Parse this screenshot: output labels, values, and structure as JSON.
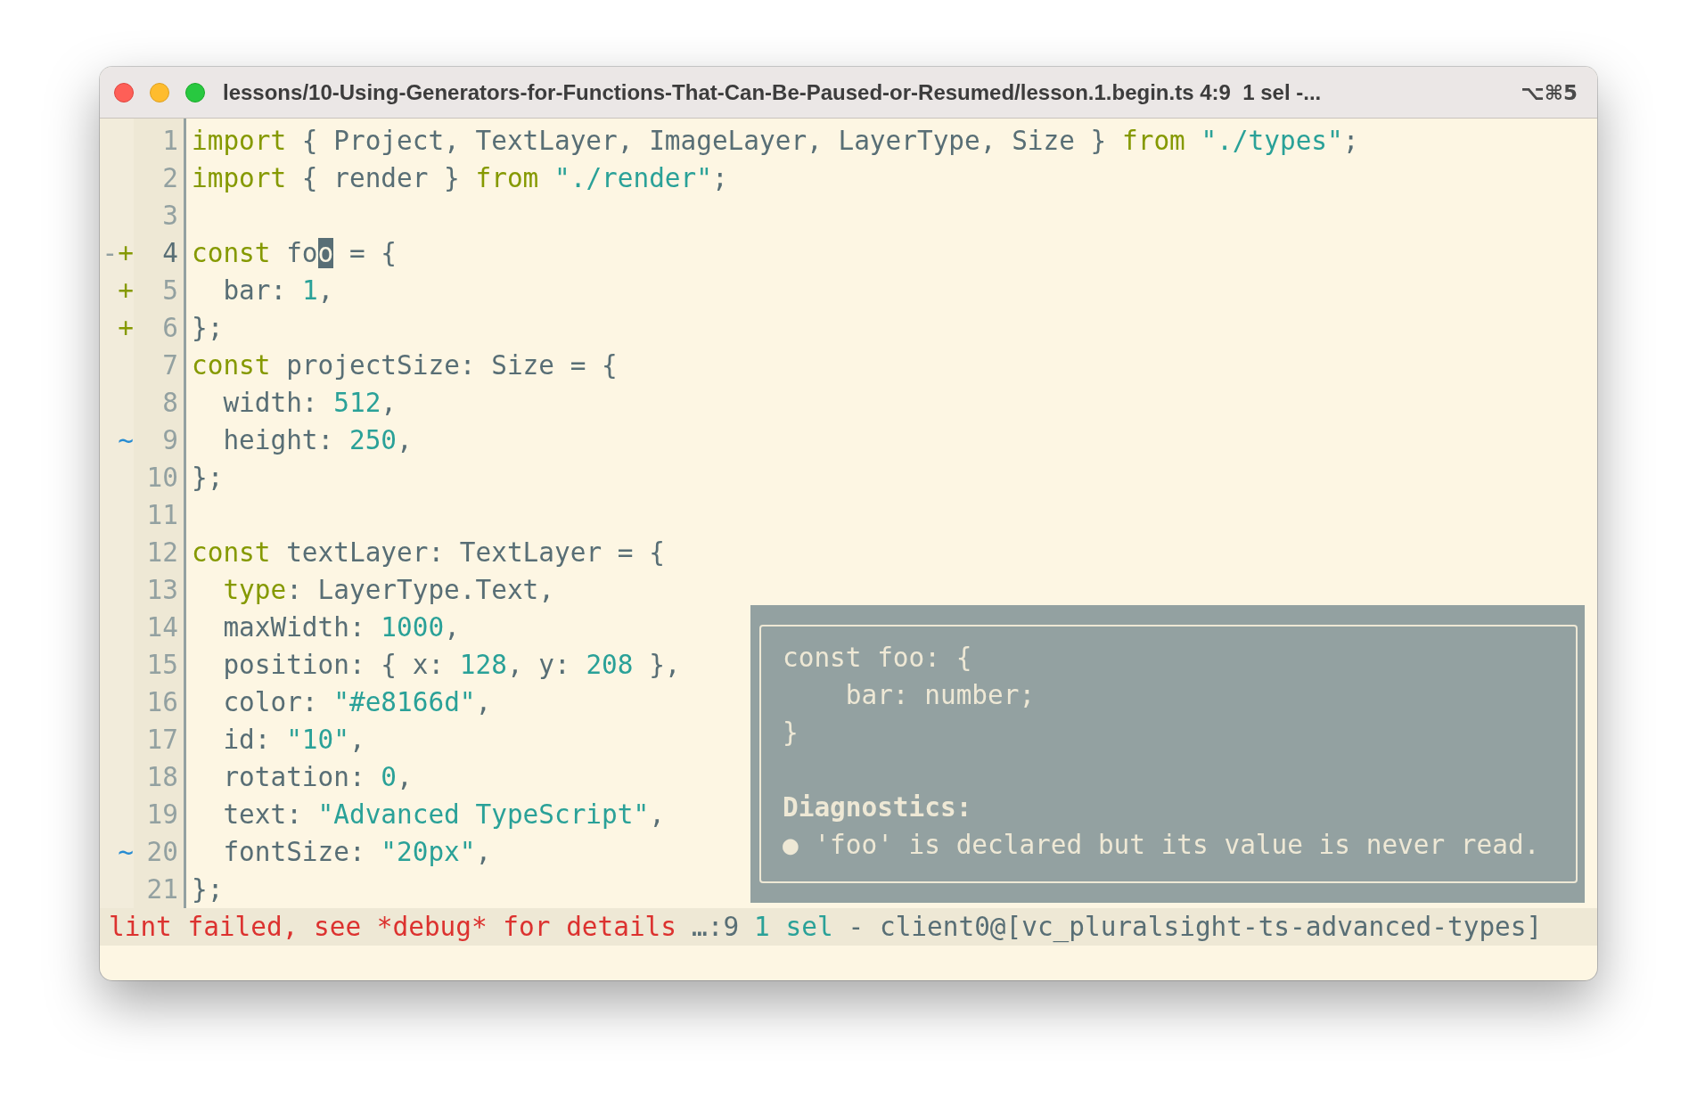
{
  "window": {
    "title": "lessons/10-Using-Generators-for-Functions-That-Can-Be-Paused-or-Resumed/lesson.1.begin.ts 4:9  1 sel -...",
    "shortcut": "⌥⌘5"
  },
  "lines": [
    {
      "number": "1",
      "current": false,
      "tokens": [
        {
          "kind": "keyword",
          "text": "import"
        },
        {
          "kind": "plain",
          "text": " { Project, TextLayer, ImageLayer, LayerType, Size } "
        },
        {
          "kind": "keyword",
          "text": "from"
        },
        {
          "kind": "string",
          "text": " \"./types\""
        },
        {
          "kind": "plain",
          "text": ";"
        }
      ]
    },
    {
      "number": "2",
      "current": false,
      "tokens": [
        {
          "kind": "keyword",
          "text": "import"
        },
        {
          "kind": "plain",
          "text": " { render } "
        },
        {
          "kind": "keyword",
          "text": "from"
        },
        {
          "kind": "string",
          "text": " \"./render\""
        },
        {
          "kind": "plain",
          "text": ";"
        }
      ]
    },
    {
      "number": "3",
      "current": false
    },
    {
      "number": "4",
      "current": true,
      "flags": [
        {
          "kind": "removed",
          "text": "-"
        },
        {
          "kind": "added",
          "text": "+"
        }
      ],
      "tokens": [
        {
          "kind": "keyword",
          "text": "const"
        },
        {
          "kind": "plain",
          "text": " fo"
        },
        {
          "kind": "cursor",
          "text": "o"
        },
        {
          "kind": "plain",
          "text": " = {"
        }
      ]
    },
    {
      "number": "5",
      "current": false,
      "flags": [
        {
          "kind": "added",
          "text": "+"
        }
      ],
      "tokens": [
        {
          "kind": "plain",
          "text": "  bar: "
        },
        {
          "kind": "string",
          "text": "1"
        },
        {
          "kind": "plain",
          "text": ","
        }
      ]
    },
    {
      "number": "6",
      "current": false,
      "flags": [
        {
          "kind": "added",
          "text": "+"
        }
      ],
      "tokens": [
        {
          "kind": "plain",
          "text": "};"
        }
      ]
    },
    {
      "number": "7",
      "current": false,
      "tokens": [
        {
          "kind": "keyword",
          "text": "const"
        },
        {
          "kind": "plain",
          "text": " projectSize: Size = {"
        }
      ]
    },
    {
      "number": "8",
      "current": false,
      "tokens": [
        {
          "kind": "plain",
          "text": "  width: "
        },
        {
          "kind": "string",
          "text": "512"
        },
        {
          "kind": "plain",
          "text": ","
        }
      ]
    },
    {
      "number": "9",
      "current": false,
      "flags": [
        {
          "kind": "modified",
          "text": "~"
        }
      ],
      "tokens": [
        {
          "kind": "plain",
          "text": "  height: "
        },
        {
          "kind": "string",
          "text": "250"
        },
        {
          "kind": "plain",
          "text": ","
        }
      ]
    },
    {
      "number": "10",
      "current": false,
      "tokens": [
        {
          "kind": "plain",
          "text": "};"
        }
      ]
    },
    {
      "number": "11",
      "current": false
    },
    {
      "number": "12",
      "current": false,
      "tokens": [
        {
          "kind": "keyword",
          "text": "const"
        },
        {
          "kind": "plain",
          "text": " textLayer: TextLayer = {"
        }
      ]
    },
    {
      "number": "13",
      "current": false,
      "tokens": [
        {
          "kind": "keyword",
          "text": "  type"
        },
        {
          "kind": "plain",
          "text": ": LayerType.Text,"
        }
      ]
    },
    {
      "number": "14",
      "current": false,
      "tokens": [
        {
          "kind": "plain",
          "text": "  maxWidth: "
        },
        {
          "kind": "string",
          "text": "1000"
        },
        {
          "kind": "plain",
          "text": ","
        }
      ]
    },
    {
      "number": "15",
      "current": false,
      "tokens": [
        {
          "kind": "plain",
          "text": "  position: { x: "
        },
        {
          "kind": "string",
          "text": "128"
        },
        {
          "kind": "plain",
          "text": ", y: "
        },
        {
          "kind": "string",
          "text": "208"
        },
        {
          "kind": "plain",
          "text": " },"
        }
      ]
    },
    {
      "number": "16",
      "current": false,
      "tokens": [
        {
          "kind": "plain",
          "text": "  color: "
        },
        {
          "kind": "string",
          "text": "\"#e8166d\""
        },
        {
          "kind": "plain",
          "text": ","
        }
      ]
    },
    {
      "number": "17",
      "current": false,
      "tokens": [
        {
          "kind": "plain",
          "text": "  id: "
        },
        {
          "kind": "string",
          "text": "\"10\""
        },
        {
          "kind": "plain",
          "text": ","
        }
      ]
    },
    {
      "number": "18",
      "current": false,
      "tokens": [
        {
          "kind": "plain",
          "text": "  rotation: "
        },
        {
          "kind": "string",
          "text": "0"
        },
        {
          "kind": "plain",
          "text": ","
        }
      ]
    },
    {
      "number": "19",
      "current": false,
      "tokens": [
        {
          "kind": "plain",
          "text": "  text: "
        },
        {
          "kind": "string",
          "text": "\"Advanced TypeScript\""
        },
        {
          "kind": "plain",
          "text": ","
        }
      ]
    },
    {
      "number": "20",
      "current": false,
      "flags": [
        {
          "kind": "modified",
          "text": "~"
        }
      ],
      "tokens": [
        {
          "kind": "plain",
          "text": "  fontSize: "
        },
        {
          "kind": "string",
          "text": "\"20px\""
        },
        {
          "kind": "plain",
          "text": ","
        }
      ]
    },
    {
      "number": "21",
      "current": false,
      "tokens": [
        {
          "kind": "plain",
          "text": "};"
        }
      ]
    }
  ],
  "hover_popup": {
    "signature": [
      "const foo: {",
      "    bar: number;",
      "}"
    ],
    "heading": "Diagnostics:",
    "diagnostics": [
      "● 'foo' is declared but its value is never read."
    ]
  },
  "status_bar": [
    {
      "kind": "error",
      "text": "lint failed, see *debug* for details"
    },
    {
      "kind": "plain",
      "text": "…:9"
    },
    {
      "kind": "info",
      "text": "1 sel"
    },
    {
      "kind": "plain",
      "text": "- client0@[vc_pluralsight-ts-advanced-types]"
    }
  ]
}
